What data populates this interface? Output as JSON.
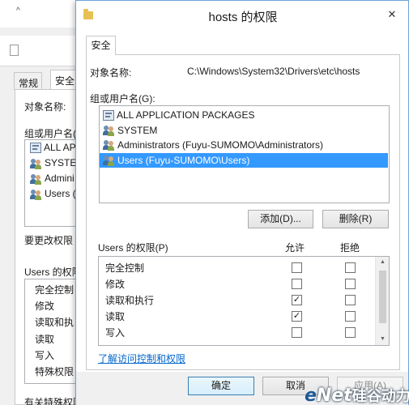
{
  "background_window": {
    "tabs": [
      "常规",
      "安全"
    ],
    "object_name_label": "对象名称:",
    "groups_label": "组或用户名(",
    "groups": [
      "ALL AP",
      "SYSTEM",
      "Admini",
      "Users ("
    ],
    "change_perm_label": "要更改权限",
    "perm_label": "Users 的权限",
    "perms": [
      "完全控制",
      "修改",
      "读取和执",
      "读取",
      "写入",
      "特殊权限"
    ],
    "bottom_label": "有关特殊权限"
  },
  "dialog": {
    "title": "hosts 的权限",
    "close_glyph": "✕",
    "tab": "安全",
    "object_name_label": "对象名称:",
    "object_name_value": "C:\\Windows\\System32\\Drivers\\etc\\hosts",
    "groups_label": "组或用户名(G):",
    "groups": [
      {
        "name": "ALL APPLICATION PACKAGES",
        "icon": "package-icon",
        "selected": false
      },
      {
        "name": "SYSTEM",
        "icon": "users-icon",
        "selected": false
      },
      {
        "name": "Administrators (Fuyu-SUMOMO\\Administrators)",
        "icon": "users-icon",
        "selected": false
      },
      {
        "name": "Users (Fuyu-SUMOMO\\Users)",
        "icon": "users-icon",
        "selected": true
      }
    ],
    "add_button": "添加(D)...",
    "remove_button": "删除(R)",
    "perm_label": "Users 的权限(P)",
    "allow_header": "允许",
    "deny_header": "拒绝",
    "permissions": [
      {
        "name": "完全控制",
        "allow": false,
        "deny": false
      },
      {
        "name": "修改",
        "allow": false,
        "deny": false
      },
      {
        "name": "读取和执行",
        "allow": true,
        "deny": false
      },
      {
        "name": "读取",
        "allow": true,
        "deny": false
      },
      {
        "name": "写入",
        "allow": false,
        "deny": false
      }
    ],
    "link": "了解访问控制和权限",
    "ok_button": "确定",
    "cancel_button": "取消",
    "apply_button": "应用(A)",
    "check_glyph": "✓"
  },
  "watermark": {
    "e": "e",
    "net": "Net",
    "cn": "硅谷动力"
  },
  "colors": {
    "selection": "#3399ff",
    "link": "#0066cc",
    "dialog_border": "#6fa3d8"
  }
}
